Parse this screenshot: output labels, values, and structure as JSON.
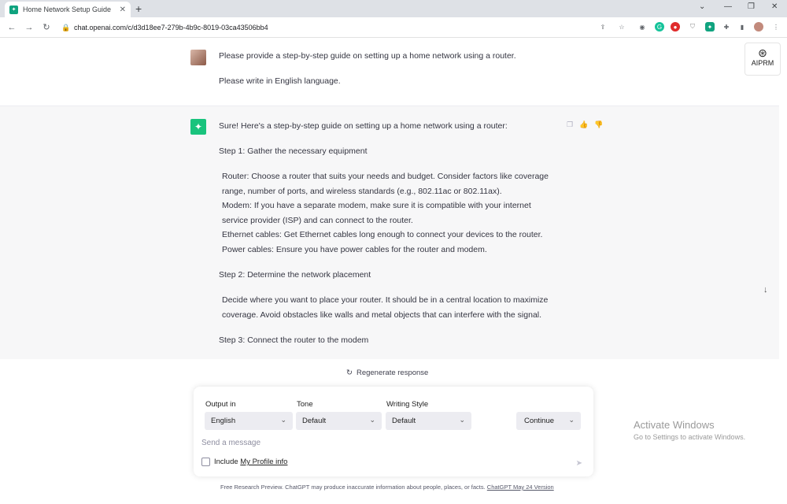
{
  "browser": {
    "tab_title": "Home Network Setup Guide",
    "url": "chat.openai.com/c/d3d18ee7-279b-4b9c-8019-03ca43506bb4"
  },
  "aiprm": {
    "label": "AIPRM"
  },
  "user_message": {
    "line1": "Please provide a step-by-step guide on setting up a home network using a router.",
    "line2": "Please write in English language."
  },
  "assistant_message": {
    "intro": "Sure! Here's a step-by-step guide on setting up a home network using a router:",
    "step1": "Step 1: Gather the necessary equipment",
    "step1_lines": [
      "Router: Choose a router that suits your needs and budget. Consider factors like coverage",
      "range, number of ports, and wireless standards (e.g., 802.11ac or 802.11ax).",
      "Modem: If you have a separate modem, make sure it is compatible with your internet",
      "service provider (ISP) and can connect to the router.",
      "Ethernet cables: Get Ethernet cables long enough to connect your devices to the router.",
      "Power cables: Ensure you have power cables for the router and modem."
    ],
    "step2": "Step 2: Determine the network placement",
    "step2_lines": [
      "Decide where you want to place your router. It should be in a central location to maximize",
      "coverage. Avoid obstacles like walls and metal objects that can interfere with the signal."
    ],
    "step3": "Step 3: Connect the router to the modem"
  },
  "regenerate": {
    "label": "Regenerate response"
  },
  "composer": {
    "output_label": "Output in",
    "output_value": "English",
    "tone_label": "Tone",
    "tone_value": "Default",
    "style_label": "Writing Style",
    "style_value": "Default",
    "continue_label": "Continue",
    "placeholder": "Send a message",
    "include_label": "Include",
    "profile_link": "My Profile info"
  },
  "footer": {
    "text": "Free Research Preview. ChatGPT may produce inaccurate information about people, places, or facts.",
    "version_link": "ChatGPT May 24 Version"
  },
  "windows_activation": {
    "title": "Activate Windows",
    "subtitle": "Go to Settings to activate Windows."
  }
}
